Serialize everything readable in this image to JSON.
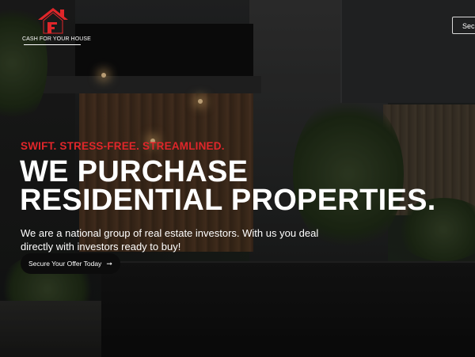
{
  "brand": {
    "logo_text": "CASH FOR YOUR HOUSE",
    "logo_color": "#e0262a"
  },
  "header": {
    "cta_label": "Secure Your Offer Today"
  },
  "hero": {
    "tagline": "SWIFT. STRESS-FREE. STREAMLINED.",
    "headline_line1": "WE PURCHASE",
    "headline_line2": "RESIDENTIAL PROPERTIES.",
    "subtext_line1": "We are a national group of real estate investors. With us you deal",
    "subtext_line2": "directly with investors ready to buy!",
    "cta_label": "Secure Your Offer Today",
    "cta_icon": "arrow-right-icon",
    "accent_color": "#e0262a"
  }
}
